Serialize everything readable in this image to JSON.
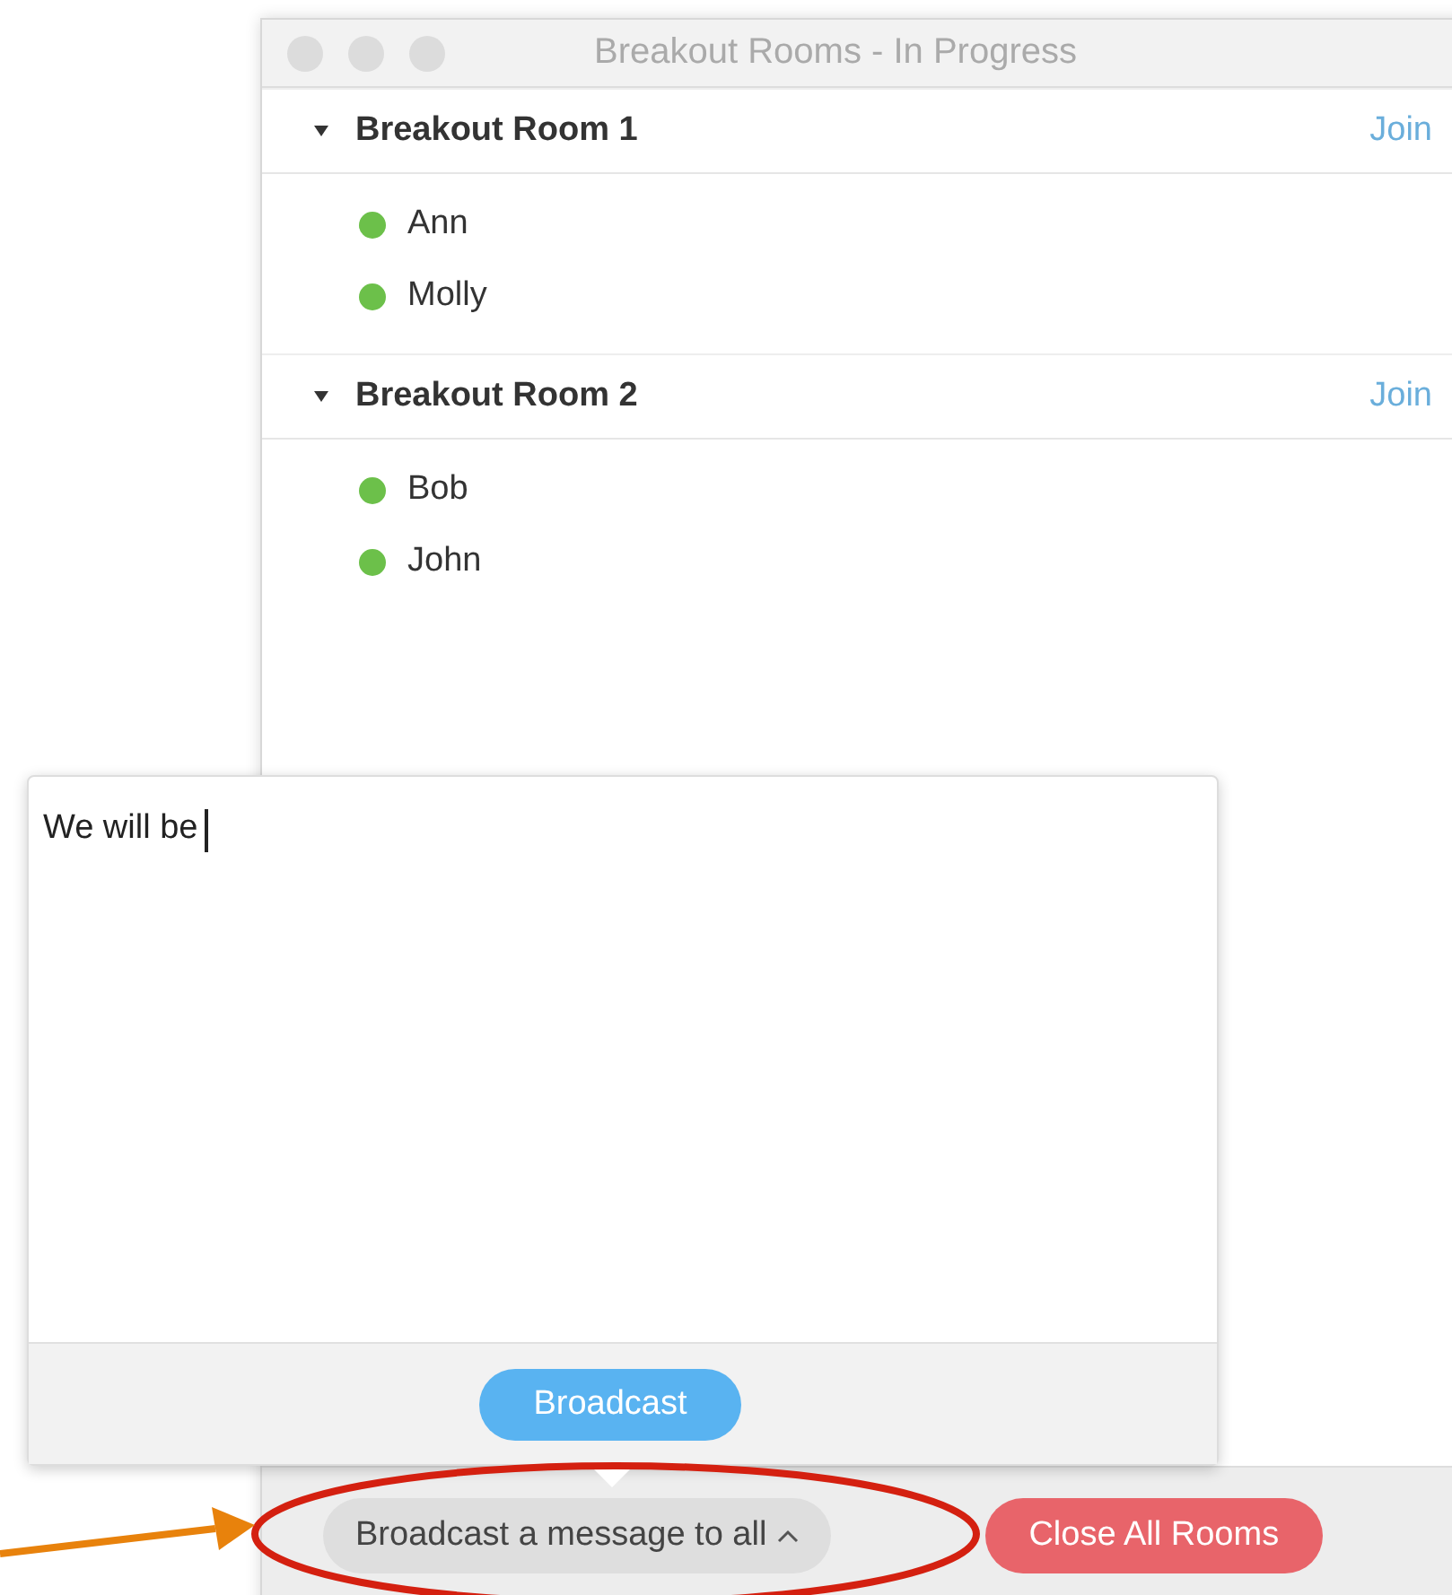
{
  "window": {
    "title": "Breakout Rooms - In Progress"
  },
  "rooms": [
    {
      "name": "Breakout Room 1",
      "expanded": true,
      "action": "Join",
      "members": [
        {
          "name": "Ann",
          "color": "#6cc04a"
        },
        {
          "name": "Molly",
          "color": "#6cc04a"
        }
      ]
    },
    {
      "name": "Breakout Room 2",
      "expanded": true,
      "action": "Join",
      "members": [
        {
          "name": "Bob",
          "color": "#6cc04a"
        },
        {
          "name": "John",
          "color": "#6cc04a"
        }
      ]
    }
  ],
  "broadcast_popup": {
    "value": "We will be",
    "button": "Broadcast"
  },
  "footer": {
    "broadcast_toggle": {
      "label": "Broadcast a message to all",
      "expanded": true
    },
    "close_button": "Close All Rooms"
  }
}
